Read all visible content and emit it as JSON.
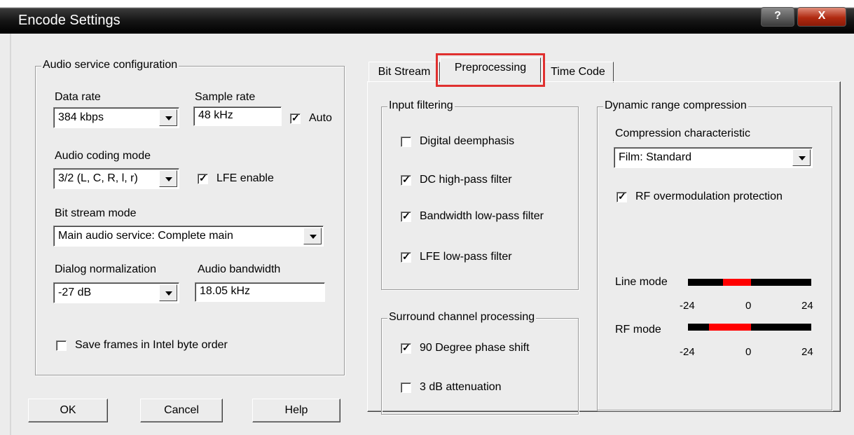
{
  "window": {
    "title": "Encode Settings",
    "help_label": "?",
    "close_label": "X"
  },
  "audio_group": {
    "legend": "Audio service configuration",
    "data_rate": {
      "label": "Data rate",
      "value": "384 kbps"
    },
    "sample_rate": {
      "label": "Sample rate",
      "value": "48 kHz"
    },
    "auto": {
      "label": "Auto",
      "checked": true
    },
    "coding_mode": {
      "label": "Audio coding mode",
      "value": "3/2 (L, C, R, l, r)"
    },
    "lfe": {
      "label": "LFE enable",
      "checked": true
    },
    "bitstream_mode": {
      "label": "Bit stream mode",
      "value": "Main audio service: Complete main"
    },
    "dialog_norm": {
      "label": "Dialog normalization",
      "value": "-27 dB"
    },
    "bandwidth": {
      "label": "Audio bandwidth",
      "value": "18.05 kHz"
    },
    "intel_order": {
      "label": "Save frames in Intel byte order",
      "checked": false
    }
  },
  "buttons": {
    "ok": "OK",
    "cancel": "Cancel",
    "help": "Help"
  },
  "tabs": [
    {
      "label": "Bit Stream",
      "selected": false
    },
    {
      "label": "Preprocessing",
      "selected": true
    },
    {
      "label": "Time Code",
      "selected": false
    }
  ],
  "input_filtering": {
    "legend": "Input filtering",
    "items": [
      {
        "label": "Digital deemphasis",
        "checked": false
      },
      {
        "label": "DC high-pass filter",
        "checked": true
      },
      {
        "label": "Bandwidth low-pass filter",
        "checked": true
      },
      {
        "label": "LFE low-pass filter",
        "checked": true
      }
    ]
  },
  "surround": {
    "legend": "Surround channel processing",
    "items": [
      {
        "label": "90 Degree phase shift",
        "checked": true
      },
      {
        "label": "3 dB attenuation",
        "checked": false
      }
    ]
  },
  "drc": {
    "legend": "Dynamic range compression",
    "characteristic": {
      "label": "Compression characteristic",
      "value": "Film: Standard"
    },
    "rf_overmod": {
      "label": "RF overmodulation protection",
      "checked": true
    },
    "line_mode": {
      "label": "Line mode",
      "ticks": [
        "-24",
        "0",
        "24"
      ]
    },
    "rf_mode": {
      "label": "RF mode",
      "ticks": [
        "-24",
        "0",
        "24"
      ]
    }
  },
  "colors": {
    "highlight": "#e0302f",
    "meter_active": "#ff0000"
  }
}
